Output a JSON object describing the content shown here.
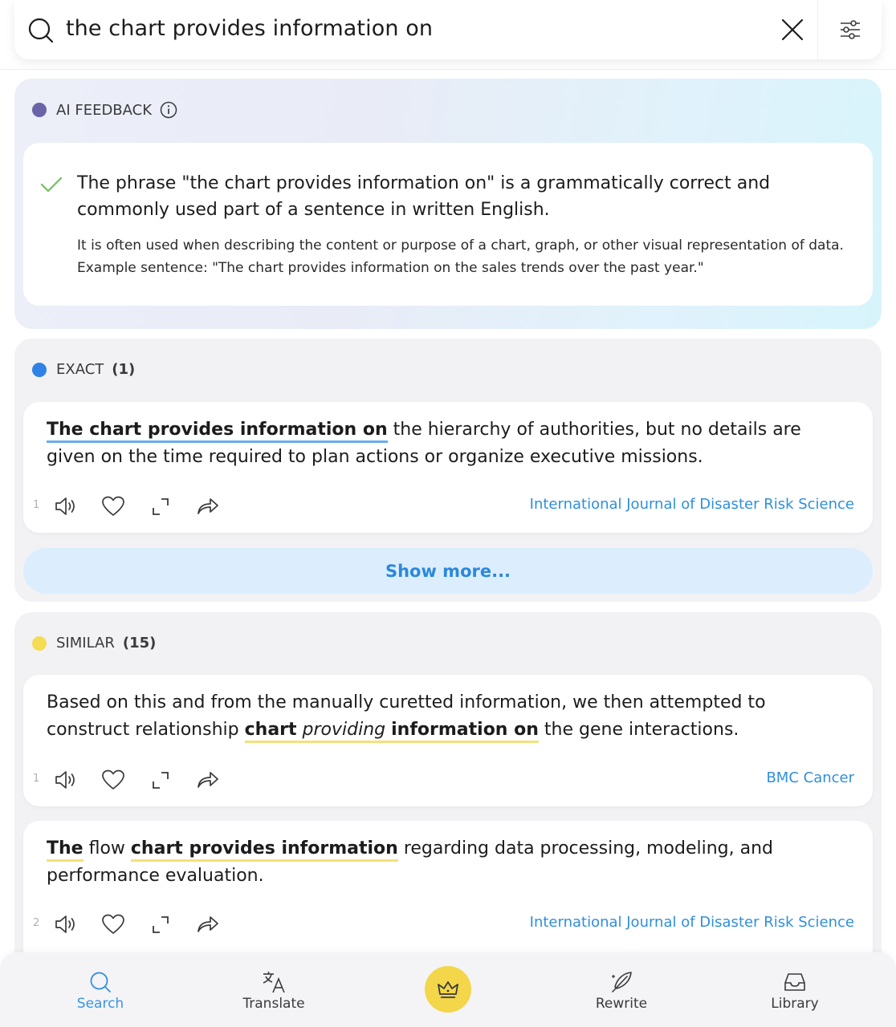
{
  "search": {
    "query": "the chart provides information on"
  },
  "ai_feedback": {
    "header": "AI FEEDBACK",
    "dot_color": "#6b63a8",
    "main_text": "The phrase \"the chart provides information on\" is a grammatically correct and commonly used part of a sentence in written English.",
    "detail_text": "It is often used when describing the content or purpose of a chart, graph, or other visual representation of data. Example sentence: \"The chart provides information on the sales trends over the past year.\""
  },
  "exact": {
    "header": "EXACT",
    "count": "(1)",
    "dot_color": "#2f82e6",
    "results": [
      {
        "number": "1",
        "highlight": "The chart provides information on",
        "rest": " the hierarchy of authorities, but no details are given on the time required to plan actions or organize executive missions.",
        "source": "International Journal of Disaster Risk Science"
      }
    ],
    "show_more": "Show more..."
  },
  "similar": {
    "header": "SIMILAR",
    "count": "(15)",
    "dot_color": "#f5dc52",
    "results": [
      {
        "number": "1",
        "pre": "Based on this and from the manually curetted information, we then attempted to construct relationship ",
        "h1": "chart",
        "h2": "providing",
        "h3": "information on",
        "post": " the gene interactions.",
        "source": "BMC Cancer"
      },
      {
        "number": "2",
        "h1": "The",
        "mid": " flow ",
        "h2": "chart provides information",
        "post": " regarding data processing, modeling, and performance evaluation.",
        "source": "International Journal of Disaster Risk Science"
      }
    ]
  },
  "nav": {
    "search": "Search",
    "translate": "Translate",
    "rewrite": "Rewrite",
    "library": "Library"
  },
  "colors": {
    "accent_blue": "#2f8fdc",
    "premium_yellow": "#f3d64a"
  }
}
